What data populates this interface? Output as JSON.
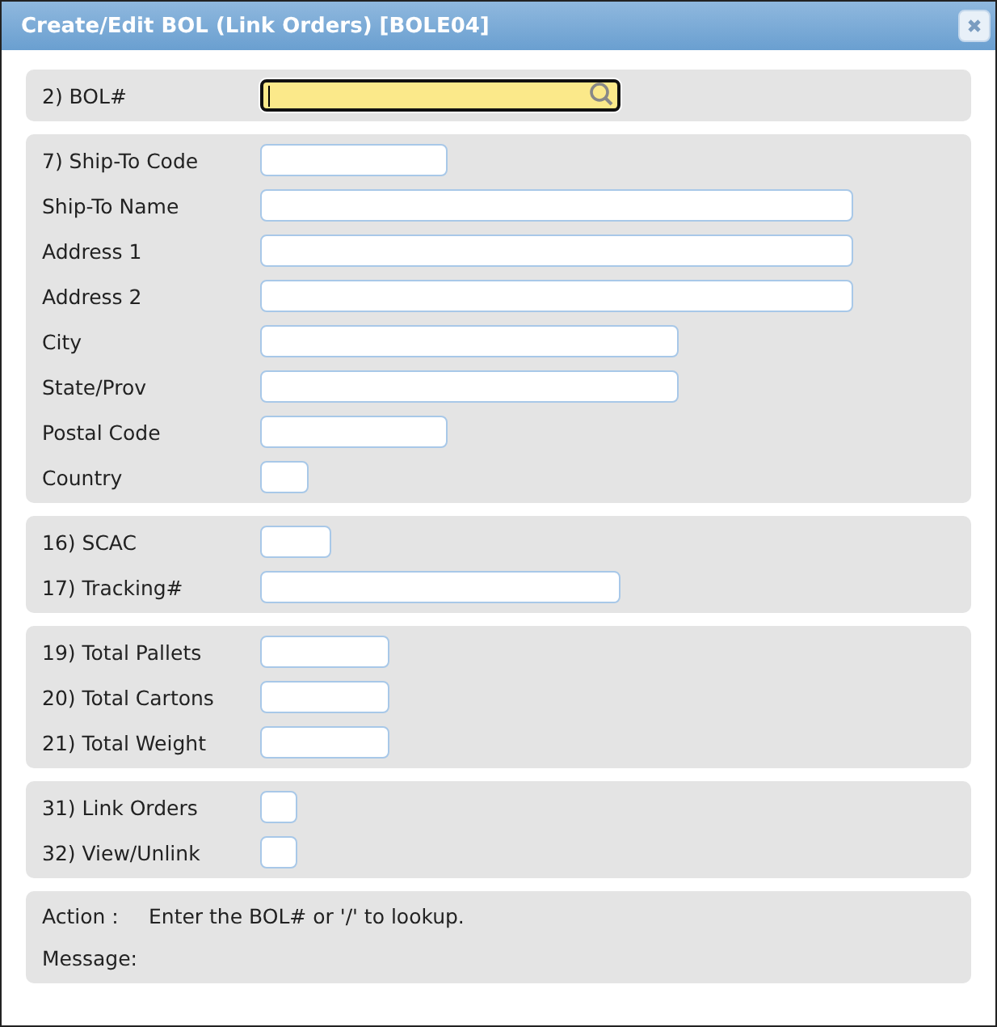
{
  "window": {
    "title": "Create/Edit BOL (Link Orders) [BOLE04]"
  },
  "sections": [
    {
      "fields": [
        {
          "label": "2) BOL#",
          "kind": "lookup",
          "focused": true
        }
      ]
    },
    {
      "fields": [
        {
          "label": "7) Ship-To Code",
          "kind": "text",
          "focused": false
        },
        {
          "label": "Ship-To Name",
          "kind": "text",
          "focused": false
        },
        {
          "label": "Address 1",
          "kind": "text",
          "focused": false
        },
        {
          "label": "Address 2",
          "kind": "text",
          "focused": false
        },
        {
          "label": "City",
          "kind": "text",
          "focused": false
        },
        {
          "label": "State/Prov",
          "kind": "text",
          "focused": false
        },
        {
          "label": "Postal Code",
          "kind": "text",
          "focused": false
        },
        {
          "label": "Country",
          "kind": "text",
          "focused": false
        }
      ]
    },
    {
      "fields": [
        {
          "label": "16) SCAC",
          "kind": "text",
          "focused": false
        },
        {
          "label": "17) Tracking#",
          "kind": "text",
          "focused": false
        }
      ]
    },
    {
      "fields": [
        {
          "label": "19) Total Pallets",
          "kind": "text",
          "focused": false
        },
        {
          "label": "20) Total Cartons",
          "kind": "text",
          "focused": false
        },
        {
          "label": "21) Total Weight",
          "kind": "text",
          "focused": false
        }
      ]
    },
    {
      "fields": [
        {
          "label": "31) Link Orders",
          "kind": "text",
          "focused": false
        },
        {
          "label": "32) View/Unlink",
          "kind": "text",
          "focused": false
        }
      ]
    }
  ],
  "status": {
    "action_label": "Action :",
    "action_text": "Enter the BOL# or '/' to lookup.",
    "message_label": "Message:"
  }
}
